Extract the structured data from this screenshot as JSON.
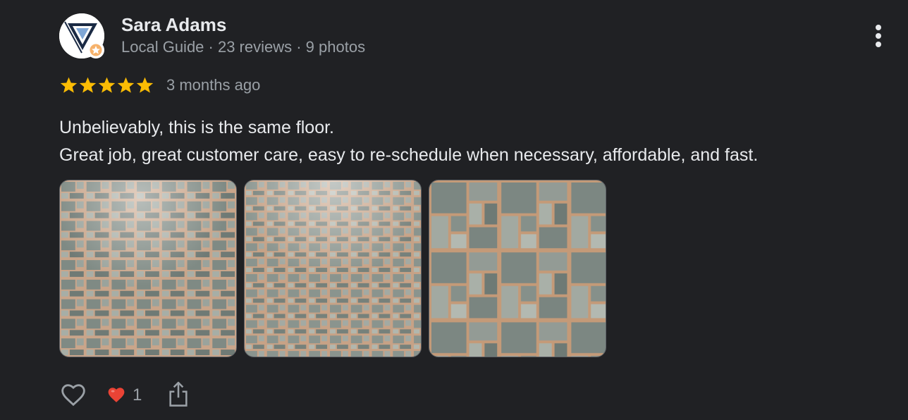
{
  "reviewer": {
    "name": "Sara Adams",
    "meta": "Local Guide · 23 reviews · 9 photos"
  },
  "rating": {
    "stars": 5,
    "max": 5,
    "color": "#fbbc04"
  },
  "time_ago": "3 months ago",
  "review_lines": [
    "Unbelievably, this is the same floor.",
    "Great job, great customer care, easy to re-schedule when necessary, affordable, and fast."
  ],
  "photos": [
    {
      "name": "photo-1",
      "subject": "tiled floor"
    },
    {
      "name": "photo-2",
      "subject": "tiled floor"
    },
    {
      "name": "photo-3",
      "subject": "tiled floor close-up"
    }
  ],
  "reactions": {
    "count": "1",
    "emoji_color": "#ea4335"
  },
  "icons": {
    "menu": "more-vertical-icon",
    "like": "heart-outline-icon",
    "reaction": "red-heart-icon",
    "share": "share-icon"
  }
}
